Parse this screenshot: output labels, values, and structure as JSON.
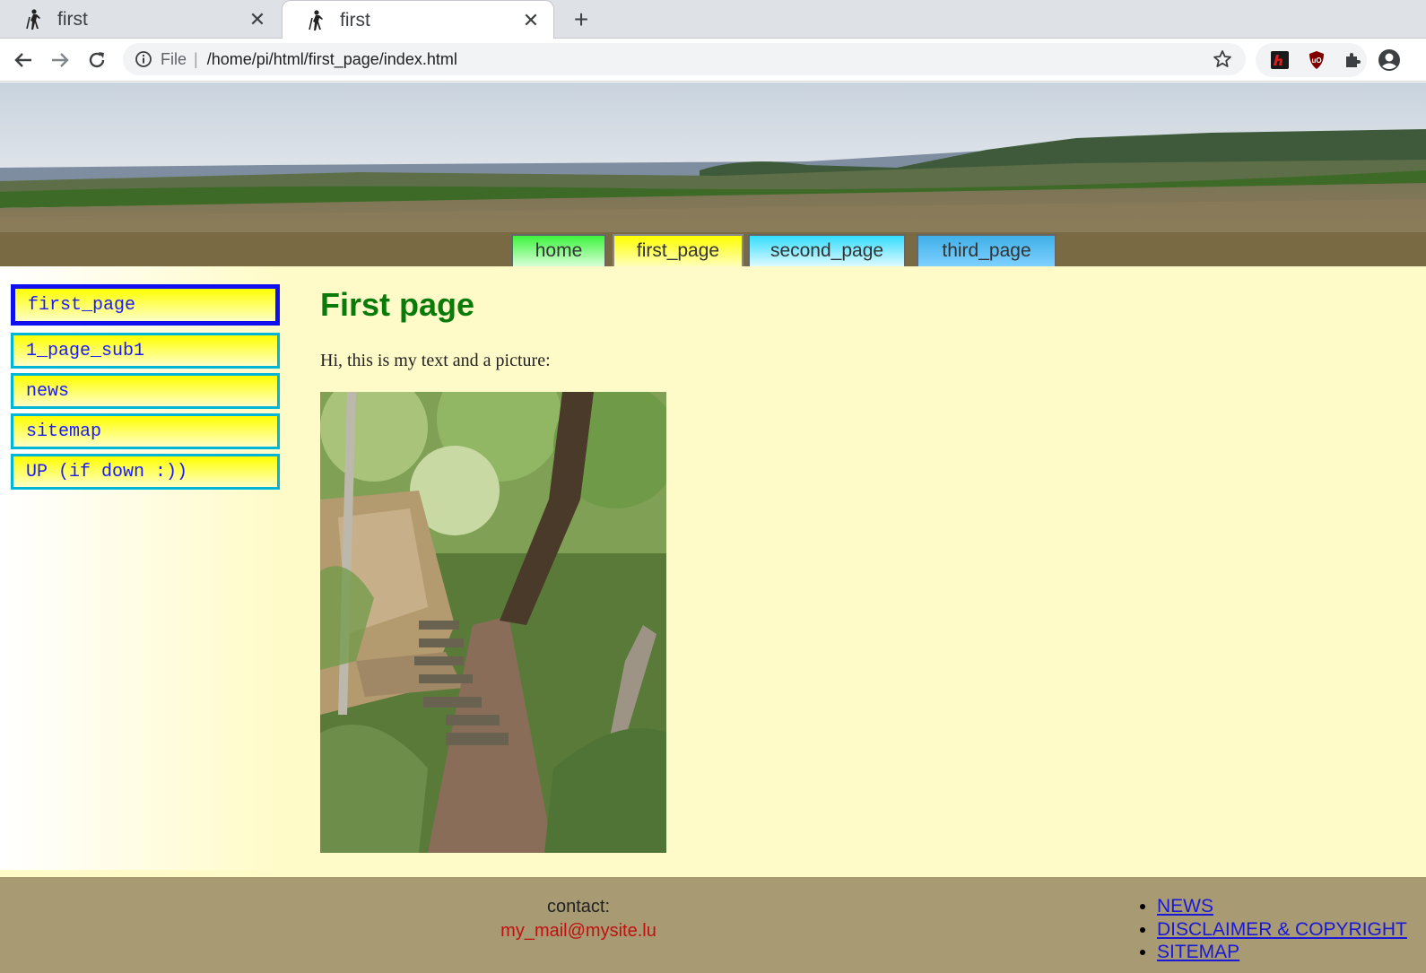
{
  "browser": {
    "tabs": [
      {
        "title": "first",
        "active": false
      },
      {
        "title": "first",
        "active": true
      }
    ],
    "address": {
      "scheme": "File",
      "url": "/home/pi/html/first_page/index.html"
    }
  },
  "topnav": {
    "items": [
      {
        "label": "home"
      },
      {
        "label": "first_page"
      },
      {
        "label": "second_page"
      },
      {
        "label": "third_page"
      }
    ]
  },
  "sidebar": {
    "items": [
      {
        "label": "first_page"
      },
      {
        "label": "1_page_sub1"
      },
      {
        "label": "news"
      },
      {
        "label": "sitemap"
      },
      {
        "label": "UP (if down :))"
      }
    ]
  },
  "main": {
    "title": "First page",
    "text": "Hi, this is my text and a picture:"
  },
  "footer": {
    "contact_label": "contact:",
    "contact_email": "my_mail@mysite.lu",
    "links": [
      {
        "label": "NEWS"
      },
      {
        "label": "DISCLAIMER & COPYRIGHT"
      },
      {
        "label": "SITEMAP"
      }
    ]
  },
  "colors": {
    "page_bg": "#fffbc8",
    "menubar_bg": "#7a6a44",
    "footer_bg": "#a89a72",
    "title_green": "#0a7a0a",
    "link_blue": "#1a1ad6",
    "email_red": "#c01010"
  }
}
